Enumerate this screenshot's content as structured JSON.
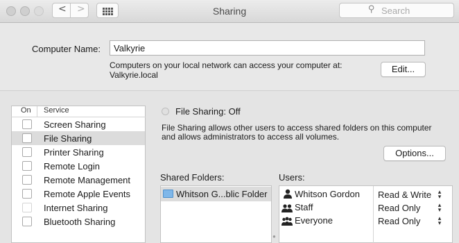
{
  "window": {
    "title": "Sharing"
  },
  "toolbar": {
    "back_label": "<",
    "forward_label": ">",
    "search_placeholder": "Search"
  },
  "computer_name": {
    "label": "Computer Name:",
    "value": "Valkyrie",
    "info_line1": "Computers on your local network can access your computer at:",
    "info_line2": "Valkyrie.local",
    "edit_label": "Edit..."
  },
  "services": {
    "header_on": "On",
    "header_service": "Service",
    "items": [
      {
        "label": "Screen Sharing",
        "checked": false,
        "enabled": true,
        "selected": false
      },
      {
        "label": "File Sharing",
        "checked": false,
        "enabled": true,
        "selected": true
      },
      {
        "label": "Printer Sharing",
        "checked": false,
        "enabled": true,
        "selected": false
      },
      {
        "label": "Remote Login",
        "checked": false,
        "enabled": true,
        "selected": false
      },
      {
        "label": "Remote Management",
        "checked": false,
        "enabled": true,
        "selected": false
      },
      {
        "label": "Remote Apple Events",
        "checked": false,
        "enabled": true,
        "selected": false
      },
      {
        "label": "Internet Sharing",
        "checked": false,
        "enabled": false,
        "selected": false
      },
      {
        "label": "Bluetooth Sharing",
        "checked": false,
        "enabled": true,
        "selected": false
      }
    ]
  },
  "detail": {
    "status": "File Sharing: Off",
    "description_line1": "File Sharing allows other users to access shared folders on this computer",
    "description_line2": "and allows administrators to access all volumes.",
    "options_label": "Options...",
    "shared_folders_label": "Shared Folders:",
    "users_label": "Users:",
    "shared_folders": [
      {
        "name": "Whitson G...blic Folder"
      }
    ],
    "users": [
      {
        "name": "Whitson Gordon",
        "permission": "Read & Write",
        "icon": "single-user-icon"
      },
      {
        "name": "Staff",
        "permission": "Read Only",
        "icon": "group-icon"
      },
      {
        "name": "Everyone",
        "permission": "Read Only",
        "icon": "everyone-icon"
      }
    ]
  }
}
